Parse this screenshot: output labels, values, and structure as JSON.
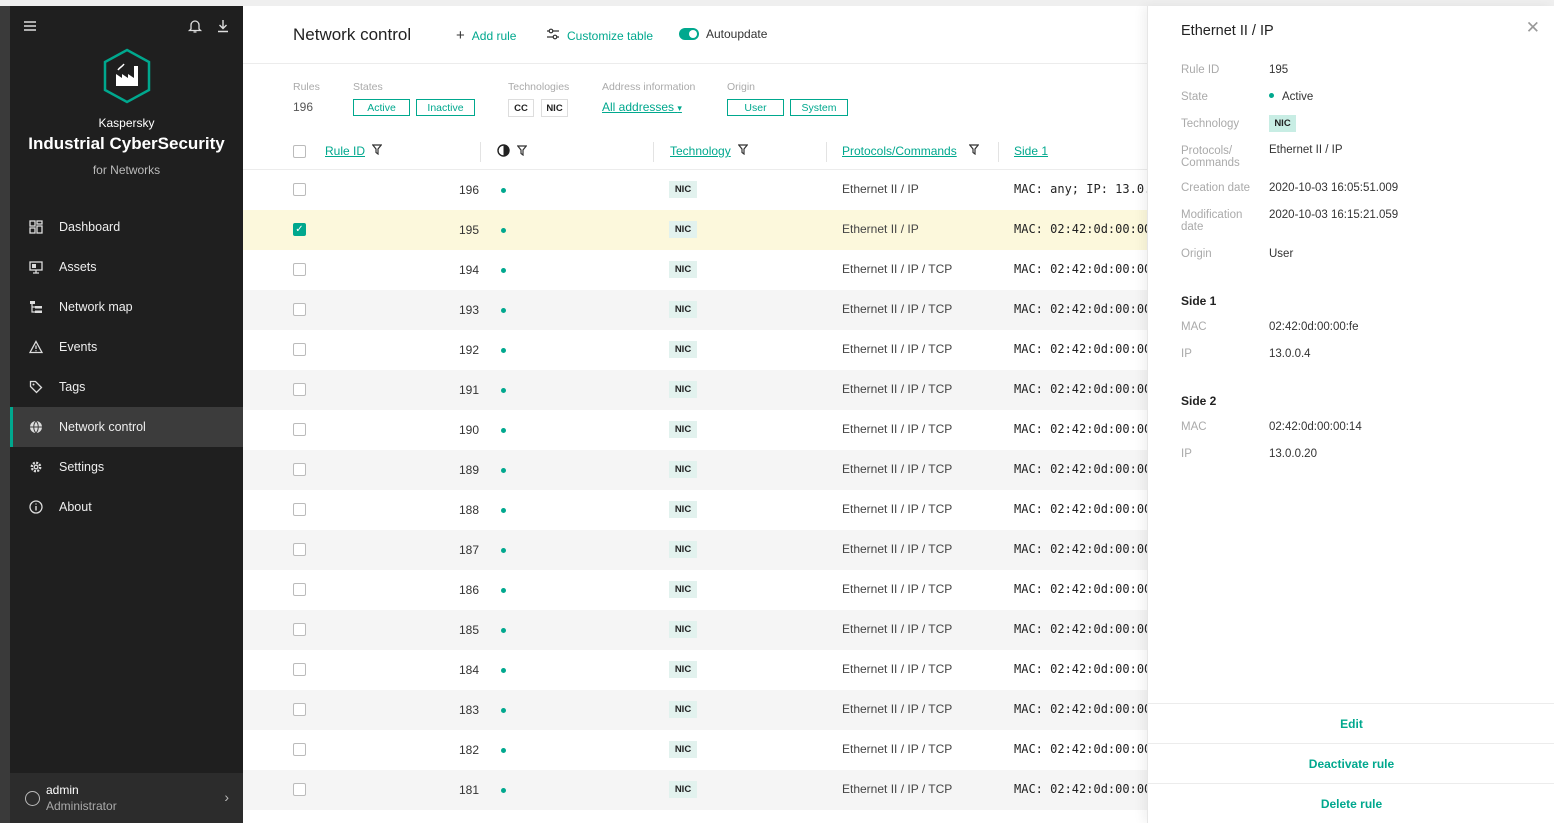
{
  "sidebar": {
    "brand_line1": "Kaspersky",
    "brand_line2": "Industrial CyberSecurity",
    "brand_line3": "for Networks",
    "nav": [
      {
        "label": "Dashboard",
        "icon": "dashboard-icon"
      },
      {
        "label": "Assets",
        "icon": "assets-icon"
      },
      {
        "label": "Network map",
        "icon": "network-map-icon"
      },
      {
        "label": "Events",
        "icon": "events-warning-icon"
      },
      {
        "label": "Tags",
        "icon": "tag-icon"
      },
      {
        "label": "Network control",
        "icon": "globe-icon",
        "active": true
      },
      {
        "label": "Settings",
        "icon": "gear-icon"
      },
      {
        "label": "About",
        "icon": "info-icon"
      }
    ],
    "user": {
      "name": "admin",
      "role": "Administrator"
    }
  },
  "toolbar": {
    "title": "Network control",
    "add_rule": "Add rule",
    "customize_table": "Customize table",
    "autoupdate": "Autoupdate",
    "autoupdate_on": true
  },
  "filters": {
    "rules_label": "Rules",
    "rules_count": "196",
    "states_label": "States",
    "state_active": "Active",
    "state_inactive": "Inactive",
    "technologies_label": "Technologies",
    "tech_cc": "CC",
    "tech_nic": "NIC",
    "address_label": "Address information",
    "address_value": "All addresses",
    "origin_label": "Origin",
    "origin_user": "User",
    "origin_system": "System"
  },
  "table": {
    "columns": {
      "rule_id": "Rule ID",
      "technology": "Technology",
      "protocols": "Protocols/Commands",
      "side1": "Side 1"
    },
    "rows": [
      {
        "id": "196",
        "tech": "NIC",
        "protocol": "Ethernet II / IP",
        "side1": "MAC: any; IP: 13.0.",
        "checked": false
      },
      {
        "id": "195",
        "tech": "NIC",
        "protocol": "Ethernet II / IP",
        "side1": "MAC: 02:42:0d:00:00",
        "checked": true
      },
      {
        "id": "194",
        "tech": "NIC",
        "protocol": "Ethernet II / IP / TCP",
        "side1": "MAC: 02:42:0d:00:00",
        "checked": false
      },
      {
        "id": "193",
        "tech": "NIC",
        "protocol": "Ethernet II / IP / TCP",
        "side1": "MAC: 02:42:0d:00:00",
        "checked": false
      },
      {
        "id": "192",
        "tech": "NIC",
        "protocol": "Ethernet II / IP / TCP",
        "side1": "MAC: 02:42:0d:00:00",
        "checked": false
      },
      {
        "id": "191",
        "tech": "NIC",
        "protocol": "Ethernet II / IP / TCP",
        "side1": "MAC: 02:42:0d:00:00",
        "checked": false
      },
      {
        "id": "190",
        "tech": "NIC",
        "protocol": "Ethernet II / IP / TCP",
        "side1": "MAC: 02:42:0d:00:00",
        "checked": false
      },
      {
        "id": "189",
        "tech": "NIC",
        "protocol": "Ethernet II / IP / TCP",
        "side1": "MAC: 02:42:0d:00:00",
        "checked": false
      },
      {
        "id": "188",
        "tech": "NIC",
        "protocol": "Ethernet II / IP / TCP",
        "side1": "MAC: 02:42:0d:00:00",
        "checked": false
      },
      {
        "id": "187",
        "tech": "NIC",
        "protocol": "Ethernet II / IP / TCP",
        "side1": "MAC: 02:42:0d:00:00",
        "checked": false
      },
      {
        "id": "186",
        "tech": "NIC",
        "protocol": "Ethernet II / IP / TCP",
        "side1": "MAC: 02:42:0d:00:00",
        "checked": false
      },
      {
        "id": "185",
        "tech": "NIC",
        "protocol": "Ethernet II / IP / TCP",
        "side1": "MAC: 02:42:0d:00:00",
        "checked": false
      },
      {
        "id": "184",
        "tech": "NIC",
        "protocol": "Ethernet II / IP / TCP",
        "side1": "MAC: 02:42:0d:00:00",
        "checked": false
      },
      {
        "id": "183",
        "tech": "NIC",
        "protocol": "Ethernet II / IP / TCP",
        "side1": "MAC: 02:42:0d:00:00",
        "checked": false
      },
      {
        "id": "182",
        "tech": "NIC",
        "protocol": "Ethernet II / IP / TCP",
        "side1": "MAC: 02:42:0d:00:00",
        "checked": false
      },
      {
        "id": "181",
        "tech": "NIC",
        "protocol": "Ethernet II / IP / TCP",
        "side1": "MAC: 02:42:0d:00:00",
        "checked": false
      }
    ]
  },
  "panel": {
    "title": "Ethernet II / IP",
    "rule_id_label": "Rule ID",
    "rule_id": "195",
    "state_label": "State",
    "state": "Active",
    "technology_label": "Technology",
    "technology": "NIC",
    "protocols_label_1": "Protocols/",
    "protocols_label_2": "Commands",
    "protocols": "Ethernet II / IP",
    "creation_label": "Creation date",
    "creation": "2020-10-03 16:05:51.009",
    "modification_label_1": "Modification",
    "modification_label_2": "date",
    "modification": "2020-10-03 16:15:21.059",
    "origin_label": "Origin",
    "origin": "User",
    "side1_title": "Side 1",
    "side1_mac_label": "MAC",
    "side1_mac": "02:42:0d:00:00:fe",
    "side1_ip_label": "IP",
    "side1_ip": "13.0.0.4",
    "side2_title": "Side 2",
    "side2_mac_label": "MAC",
    "side2_mac": "02:42:0d:00:00:14",
    "side2_ip_label": "IP",
    "side2_ip": "13.0.0.20",
    "edit": "Edit",
    "deactivate": "Deactivate rule",
    "delete": "Delete rule"
  },
  "colors": {
    "accent": "#00a88e",
    "sidebar_bg": "#1f1f1f",
    "selected_row": "#fcf8dc"
  }
}
